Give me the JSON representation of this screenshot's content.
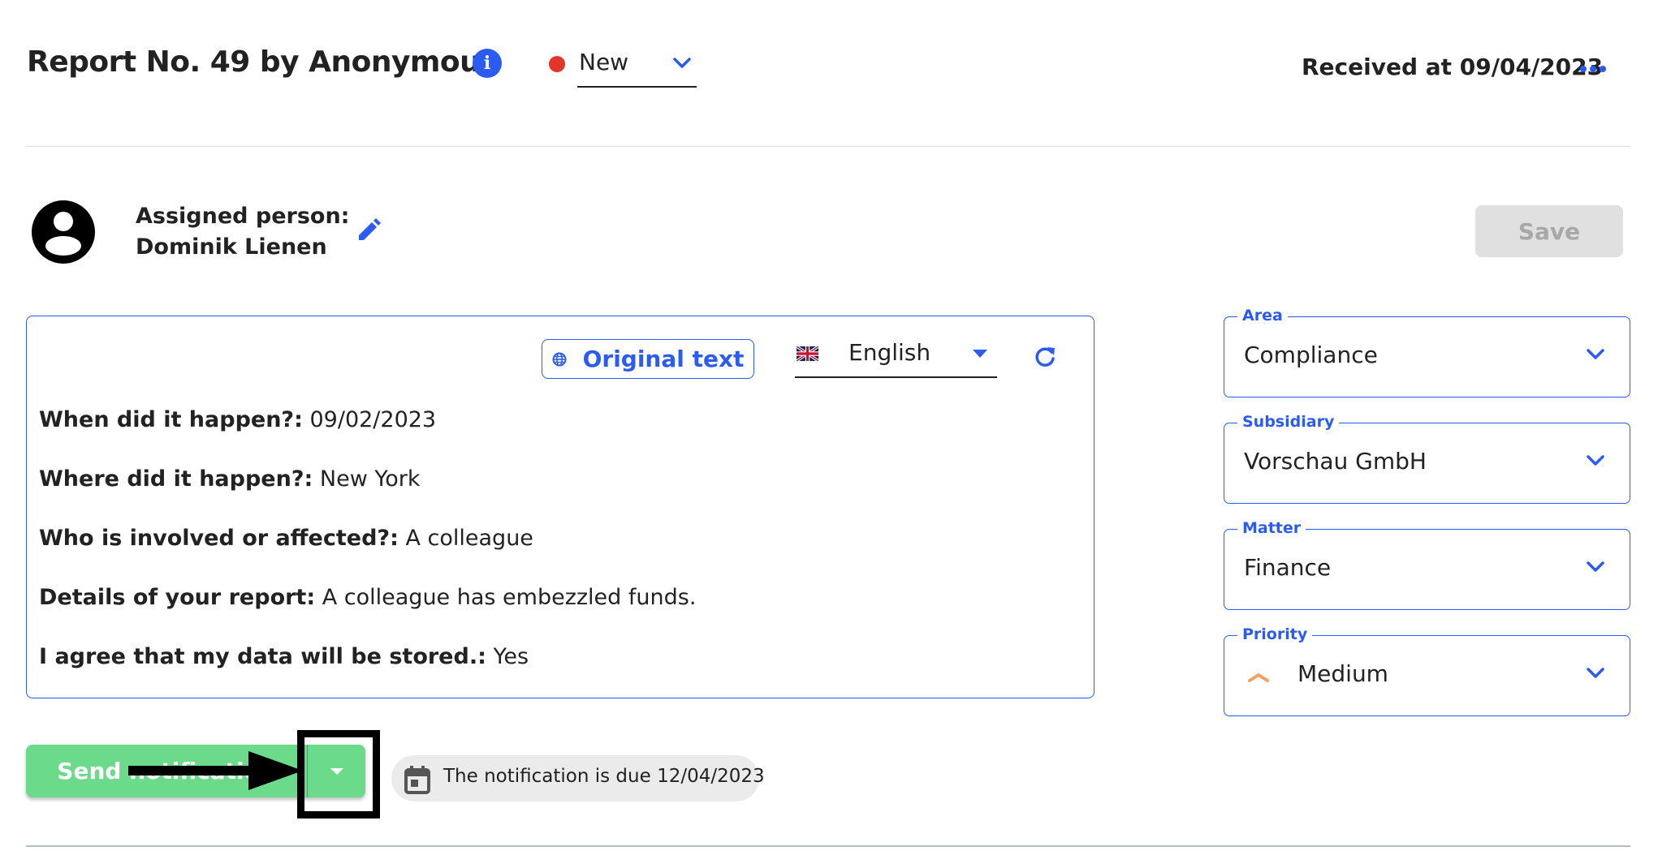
{
  "header": {
    "title": "Report No. 49 by Anonymous",
    "info_icon": "info-icon",
    "status": {
      "value": "New",
      "color": "#E5352B"
    },
    "received": "Received at 09/04/2023",
    "more_icon": "more-horizontal-icon"
  },
  "assigned": {
    "label": "Assigned person:",
    "name": "Dominik Lienen"
  },
  "toolbar": {
    "save_label": "Save"
  },
  "content": {
    "original_text_label": "Original text",
    "language": "English",
    "fields": [
      {
        "label": "When did it happen?:",
        "value": " 09/02/2023"
      },
      {
        "label": "Where did it happen?:",
        "value": " New York"
      },
      {
        "label": "Who is involved or affected?:",
        "value": " A colleague"
      },
      {
        "label": "Details of your report:",
        "value": " A colleague has embezzled funds."
      },
      {
        "label": "I agree that my data will be stored.:",
        "value": " Yes"
      }
    ]
  },
  "selects": {
    "area": {
      "label": "Area",
      "value": "Compliance"
    },
    "subsidiary": {
      "label": "Subsidiary",
      "value": "Vorschau GmbH"
    },
    "matter": {
      "label": "Matter",
      "value": "Finance"
    },
    "priority": {
      "label": "Priority",
      "value": "Medium",
      "icon_color": "#F0A060"
    }
  },
  "notification": {
    "send_label": "Send notification",
    "due_text": "The notification is due 12/04/2023"
  },
  "colors": {
    "accent": "#2B5BF0",
    "send_green": "#6BDB8B",
    "status_new": "#E5352B"
  }
}
